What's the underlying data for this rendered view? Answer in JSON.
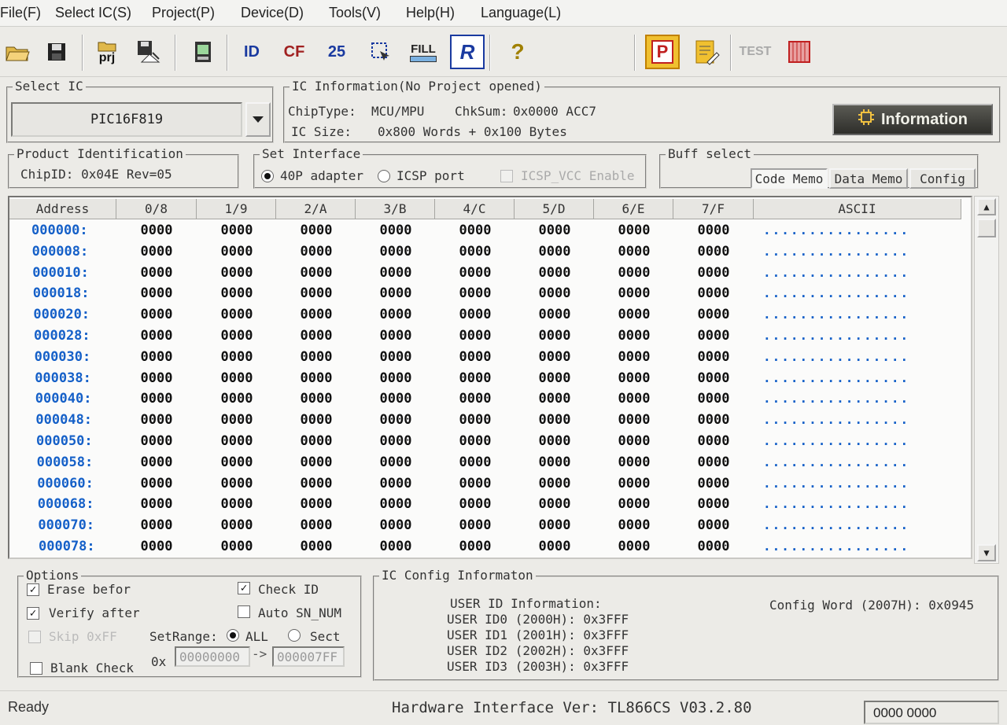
{
  "menu": [
    "File(F)",
    "Select IC(S)",
    "Project(P)",
    "Device(D)",
    "Tools(V)",
    "Help(H)",
    "Language(L)"
  ],
  "toolbar": {
    "prj": "prj",
    "fill": "FILL",
    "r": "R",
    "help": "?",
    "p": "P",
    "test": "TEST",
    "id": "ID",
    "cf": "CF",
    "n25": "25"
  },
  "select_ic": {
    "title": "Select IC",
    "chip": "PIC16F819"
  },
  "ic_info": {
    "title": "IC Information(No Project opened)",
    "chiptype_label": "ChipType:",
    "chiptype": "MCU/MPU",
    "chksum_label": "ChkSum:",
    "chksum": "0x0000 ACC7",
    "size_label": "IC Size:",
    "size": "0x800 Words + 0x100 Bytes",
    "info_button": "Information"
  },
  "product_id": {
    "title": "Product Identification",
    "chipid": "ChipID: 0x04E Rev=05"
  },
  "interface": {
    "title": "Set Interface",
    "opt1": "40P adapter",
    "opt2": "ICSP port",
    "icsp_vcc": "ICSP_VCC Enable"
  },
  "buff": {
    "title": "Buff select",
    "code": "Code Memo",
    "data": "Data Memo",
    "config": "Config"
  },
  "grid": {
    "headers": [
      "Address",
      "0/8",
      "1/9",
      "2/A",
      "3/B",
      "4/C",
      "5/D",
      "6/E",
      "7/F",
      "ASCII"
    ],
    "rows": [
      {
        "addr": "000000:",
        "v": [
          "0000",
          "0000",
          "0000",
          "0000",
          "0000",
          "0000",
          "0000",
          "0000"
        ],
        "a": "................"
      },
      {
        "addr": "000008:",
        "v": [
          "0000",
          "0000",
          "0000",
          "0000",
          "0000",
          "0000",
          "0000",
          "0000"
        ],
        "a": "................"
      },
      {
        "addr": "000010:",
        "v": [
          "0000",
          "0000",
          "0000",
          "0000",
          "0000",
          "0000",
          "0000",
          "0000"
        ],
        "a": "................"
      },
      {
        "addr": "000018:",
        "v": [
          "0000",
          "0000",
          "0000",
          "0000",
          "0000",
          "0000",
          "0000",
          "0000"
        ],
        "a": "................"
      },
      {
        "addr": "000020:",
        "v": [
          "0000",
          "0000",
          "0000",
          "0000",
          "0000",
          "0000",
          "0000",
          "0000"
        ],
        "a": "................"
      },
      {
        "addr": "000028:",
        "v": [
          "0000",
          "0000",
          "0000",
          "0000",
          "0000",
          "0000",
          "0000",
          "0000"
        ],
        "a": "................"
      },
      {
        "addr": "000030:",
        "v": [
          "0000",
          "0000",
          "0000",
          "0000",
          "0000",
          "0000",
          "0000",
          "0000"
        ],
        "a": "................"
      },
      {
        "addr": "000038:",
        "v": [
          "0000",
          "0000",
          "0000",
          "0000",
          "0000",
          "0000",
          "0000",
          "0000"
        ],
        "a": "................"
      },
      {
        "addr": "000040:",
        "v": [
          "0000",
          "0000",
          "0000",
          "0000",
          "0000",
          "0000",
          "0000",
          "0000"
        ],
        "a": "................"
      },
      {
        "addr": "000048:",
        "v": [
          "0000",
          "0000",
          "0000",
          "0000",
          "0000",
          "0000",
          "0000",
          "0000"
        ],
        "a": "................"
      },
      {
        "addr": "000050:",
        "v": [
          "0000",
          "0000",
          "0000",
          "0000",
          "0000",
          "0000",
          "0000",
          "0000"
        ],
        "a": "................"
      },
      {
        "addr": "000058:",
        "v": [
          "0000",
          "0000",
          "0000",
          "0000",
          "0000",
          "0000",
          "0000",
          "0000"
        ],
        "a": "................"
      },
      {
        "addr": "000060:",
        "v": [
          "0000",
          "0000",
          "0000",
          "0000",
          "0000",
          "0000",
          "0000",
          "0000"
        ],
        "a": "................"
      },
      {
        "addr": "000068:",
        "v": [
          "0000",
          "0000",
          "0000",
          "0000",
          "0000",
          "0000",
          "0000",
          "0000"
        ],
        "a": "................"
      },
      {
        "addr": "000070:",
        "v": [
          "0000",
          "0000",
          "0000",
          "0000",
          "0000",
          "0000",
          "0000",
          "0000"
        ],
        "a": "................"
      },
      {
        "addr": "000078:",
        "v": [
          "0000",
          "0000",
          "0000",
          "0000",
          "0000",
          "0000",
          "0000",
          "0000"
        ],
        "a": "................"
      }
    ]
  },
  "options": {
    "title": "Options",
    "erase": "Erase befor",
    "verify": "Verify after",
    "skip": "Skip 0xFF",
    "blank": "Blank Check",
    "checkid": "Check ID",
    "autosn": "Auto SN_NUM",
    "setrange": "SetRange:",
    "all": "ALL",
    "sect": "Sect",
    "ox": "0x",
    "from": "00000000",
    "arrow": "->",
    "to": "000007FF"
  },
  "config_info": {
    "title": "IC Config Informaton",
    "user_title": "USER ID Information:",
    "ids": [
      "USER ID0 (2000H): 0x3FFF",
      "USER ID1 (2001H): 0x3FFF",
      "USER ID2 (2002H): 0x3FFF",
      "USER ID3 (2003H): 0x3FFF"
    ],
    "config_word": "Config Word (2007H): 0x0945"
  },
  "status": {
    "ready": "Ready",
    "hw": "Hardware Interface Ver: TL866CS V03.2.80",
    "counter": "0000 0000"
  },
  "colors": {
    "accent_blue": "#1560c8",
    "info_button_bg": "#3a3a36",
    "save_red": "#c02020"
  }
}
